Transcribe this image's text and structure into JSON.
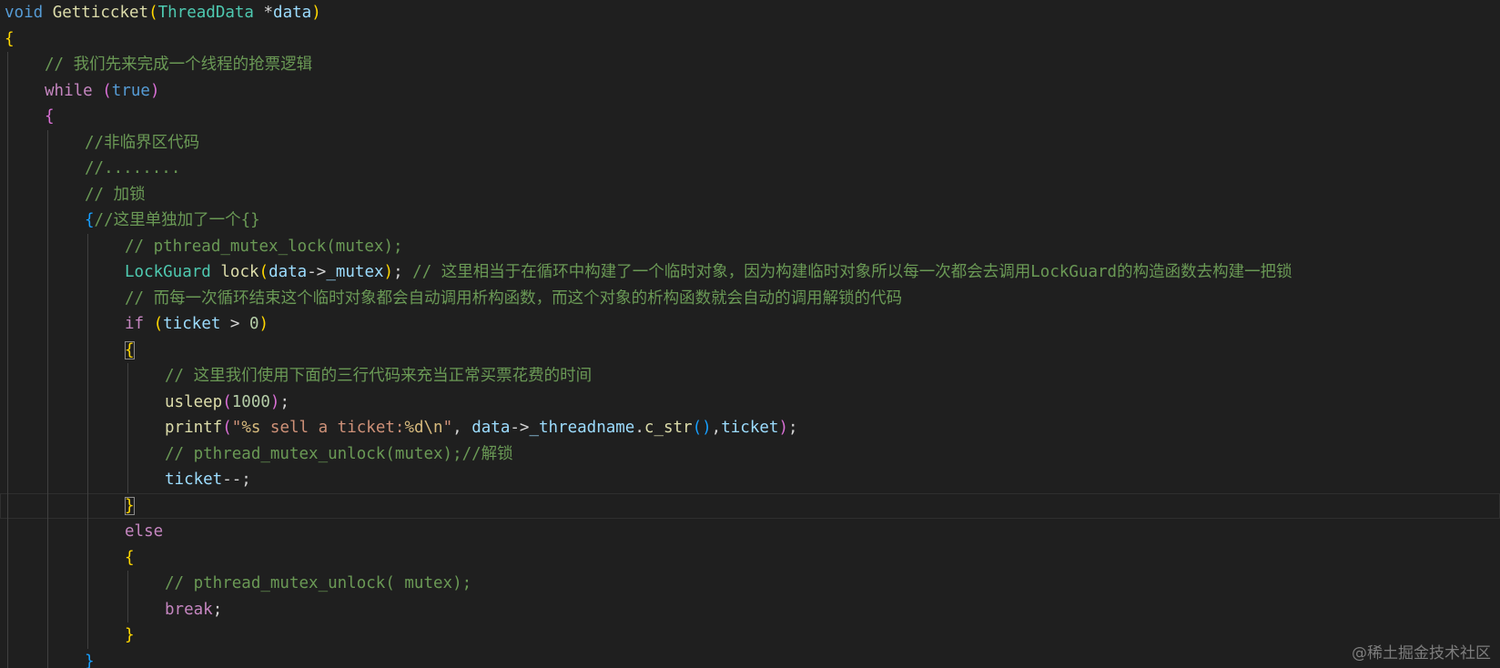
{
  "editor": {
    "theme_colors": {
      "background": "#1f1f1f",
      "keyword": "#569cd6",
      "control": "#c586c0",
      "function": "#dcdcaa",
      "type": "#4ec9b0",
      "variable": "#9cdcfe",
      "comment": "#6a9955",
      "string": "#ce9178",
      "number": "#b5cea8",
      "bracket_level1": "#ffd700",
      "bracket_level2": "#da70d6",
      "bracket_level3": "#179fff"
    },
    "lines": [
      {
        "id": 1,
        "indent": 0,
        "tokens": [
          {
            "t": "void",
            "c": "kw"
          },
          {
            "t": " ",
            "c": "pl"
          },
          {
            "t": "Getticcket",
            "c": "fn"
          },
          {
            "t": "(",
            "c": "b1"
          },
          {
            "t": "ThreadData",
            "c": "ty"
          },
          {
            "t": " *",
            "c": "pl"
          },
          {
            "t": "data",
            "c": "param"
          },
          {
            "t": ")",
            "c": "b1"
          }
        ]
      },
      {
        "id": 2,
        "indent": 0,
        "tokens": [
          {
            "t": "{",
            "c": "b1"
          }
        ]
      },
      {
        "id": 3,
        "indent": 1,
        "tokens": [
          {
            "t": "// 我们先来完成一个线程的抢票逻辑",
            "c": "cmt"
          }
        ]
      },
      {
        "id": 4,
        "indent": 1,
        "tokens": [
          {
            "t": "while",
            "c": "ctl"
          },
          {
            "t": " ",
            "c": "pl"
          },
          {
            "t": "(",
            "c": "b2"
          },
          {
            "t": "true",
            "c": "kw"
          },
          {
            "t": ")",
            "c": "b2"
          }
        ]
      },
      {
        "id": 5,
        "indent": 1,
        "tokens": [
          {
            "t": "{",
            "c": "b2"
          }
        ]
      },
      {
        "id": 6,
        "indent": 2,
        "tokens": [
          {
            "t": "//非临界区代码",
            "c": "cmt"
          }
        ]
      },
      {
        "id": 7,
        "indent": 2,
        "tokens": [
          {
            "t": "//........",
            "c": "cmt"
          }
        ]
      },
      {
        "id": 8,
        "indent": 2,
        "tokens": [
          {
            "t": "// 加锁",
            "c": "cmt"
          }
        ]
      },
      {
        "id": 9,
        "indent": 2,
        "tokens": [
          {
            "t": "{",
            "c": "b3"
          },
          {
            "t": "//这里单独加了一个{}",
            "c": "cmt"
          }
        ]
      },
      {
        "id": 10,
        "indent": 3,
        "tokens": [
          {
            "t": "// pthread_mutex_lock(mutex);",
            "c": "cmt"
          }
        ]
      },
      {
        "id": 11,
        "indent": 3,
        "tokens": [
          {
            "t": "LockGuard",
            "c": "ty"
          },
          {
            "t": " ",
            "c": "pl"
          },
          {
            "t": "lock",
            "c": "fn"
          },
          {
            "t": "(",
            "c": "b1"
          },
          {
            "t": "data",
            "c": "param"
          },
          {
            "t": "->",
            "c": "pl"
          },
          {
            "t": "_mutex",
            "c": "var"
          },
          {
            "t": ")",
            "c": "b1"
          },
          {
            "t": "; ",
            "c": "pl"
          },
          {
            "t": "// 这里相当于在循环中构建了一个临时对象，因为构建临时对象所以每一次都会去调用LockGuard的构造函数去构建一把锁",
            "c": "cmt"
          }
        ]
      },
      {
        "id": 12,
        "indent": 3,
        "tokens": [
          {
            "t": "// 而每一次循环结束这个临时对象都会自动调用析构函数，而这个对象的析构函数就会自动的调用解锁的代码",
            "c": "cmt"
          }
        ]
      },
      {
        "id": 13,
        "indent": 3,
        "tokens": [
          {
            "t": "if",
            "c": "ctl"
          },
          {
            "t": " ",
            "c": "pl"
          },
          {
            "t": "(",
            "c": "b1"
          },
          {
            "t": "ticket",
            "c": "var"
          },
          {
            "t": " > ",
            "c": "pl"
          },
          {
            "t": "0",
            "c": "num"
          },
          {
            "t": ")",
            "c": "b1"
          }
        ]
      },
      {
        "id": 14,
        "indent": 3,
        "tokens": [
          {
            "t": "{",
            "c": "b1",
            "match": true
          }
        ]
      },
      {
        "id": 15,
        "indent": 4,
        "tokens": [
          {
            "t": "// 这里我们使用下面的三行代码来充当正常买票花费的时间",
            "c": "cmt"
          }
        ]
      },
      {
        "id": 16,
        "indent": 4,
        "tokens": [
          {
            "t": "usleep",
            "c": "fn"
          },
          {
            "t": "(",
            "c": "b2"
          },
          {
            "t": "1000",
            "c": "num"
          },
          {
            "t": ")",
            "c": "b2"
          },
          {
            "t": ";",
            "c": "pl"
          }
        ]
      },
      {
        "id": 17,
        "indent": 4,
        "tokens": [
          {
            "t": "printf",
            "c": "fn"
          },
          {
            "t": "(",
            "c": "b2"
          },
          {
            "t": "\"",
            "c": "str"
          },
          {
            "t": "%s",
            "c": "esc"
          },
          {
            "t": " sell a ticket:",
            "c": "str"
          },
          {
            "t": "%d\\n",
            "c": "esc"
          },
          {
            "t": "\"",
            "c": "str"
          },
          {
            "t": ", ",
            "c": "pl"
          },
          {
            "t": "data",
            "c": "param"
          },
          {
            "t": "->",
            "c": "pl"
          },
          {
            "t": "_threadname",
            "c": "var"
          },
          {
            "t": ".",
            "c": "pl"
          },
          {
            "t": "c_str",
            "c": "fn"
          },
          {
            "t": "()",
            "c": "b3"
          },
          {
            "t": ",",
            "c": "pl"
          },
          {
            "t": "ticket",
            "c": "var"
          },
          {
            "t": ")",
            "c": "b2"
          },
          {
            "t": ";",
            "c": "pl"
          }
        ]
      },
      {
        "id": 18,
        "indent": 4,
        "tokens": [
          {
            "t": "// pthread_mutex_unlock(mutex);//解锁",
            "c": "cmt"
          }
        ]
      },
      {
        "id": 19,
        "indent": 4,
        "tokens": [
          {
            "t": "ticket",
            "c": "var"
          },
          {
            "t": "--;",
            "c": "pl"
          }
        ]
      },
      {
        "id": 20,
        "indent": 3,
        "current": true,
        "tokens": [
          {
            "t": "}",
            "c": "b1",
            "match": true
          }
        ]
      },
      {
        "id": 21,
        "indent": 3,
        "tokens": [
          {
            "t": "else",
            "c": "ctl"
          }
        ]
      },
      {
        "id": 22,
        "indent": 3,
        "tokens": [
          {
            "t": "{",
            "c": "b1"
          }
        ]
      },
      {
        "id": 23,
        "indent": 4,
        "tokens": [
          {
            "t": "// pthread_mutex_unlock( mutex);",
            "c": "cmt"
          }
        ]
      },
      {
        "id": 24,
        "indent": 4,
        "tokens": [
          {
            "t": "break",
            "c": "ctl"
          },
          {
            "t": ";",
            "c": "pl"
          }
        ]
      },
      {
        "id": 25,
        "indent": 3,
        "tokens": [
          {
            "t": "}",
            "c": "b1"
          }
        ]
      },
      {
        "id": 26,
        "indent": 2,
        "tokens": [
          {
            "t": "}",
            "c": "b3"
          }
        ]
      }
    ]
  },
  "watermark": {
    "text": "@稀土掘金技术社区"
  }
}
